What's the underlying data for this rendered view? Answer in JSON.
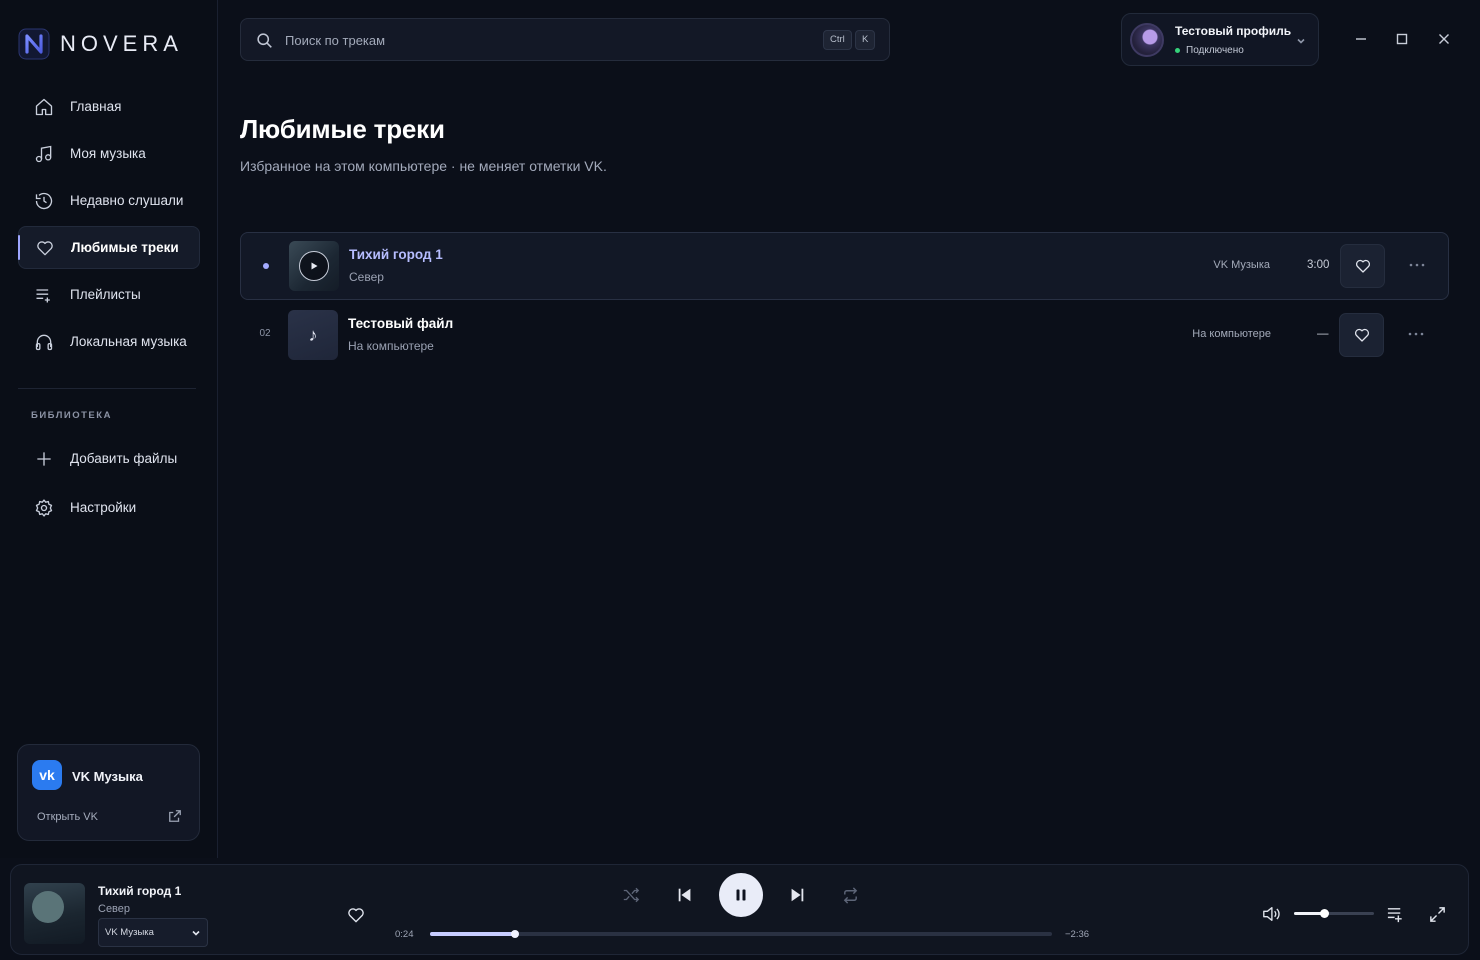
{
  "brand": {
    "name": "NOVERA"
  },
  "nav": {
    "items": [
      {
        "label": "Главная",
        "icon": "home-icon"
      },
      {
        "label": "Моя музыка",
        "icon": "music-note-icon"
      },
      {
        "label": "Недавно слушали",
        "icon": "history-icon"
      },
      {
        "label": "Любимые треки",
        "icon": "heart-icon",
        "active": true
      },
      {
        "label": "Плейлисты",
        "icon": "playlist-icon"
      },
      {
        "label": "Локальная музыка",
        "icon": "headphones-icon"
      }
    ]
  },
  "library": {
    "title": "БИБЛИОТЕКА",
    "items": [
      {
        "label": "Добавить файлы",
        "icon": "plus-icon"
      },
      {
        "label": "Настройки",
        "icon": "settings-gear-icon"
      }
    ]
  },
  "vk_card": {
    "title": "VK Музыка",
    "logo": "vk",
    "open_label": "Открыть VK"
  },
  "search": {
    "placeholder": "Поиск по трекам",
    "value": "",
    "shortcut": [
      "Ctrl",
      "K"
    ]
  },
  "profile": {
    "name": "Тестовый профиль",
    "status": "Подключено",
    "status_color": "#35d27a"
  },
  "page": {
    "title": "Любимые треки",
    "subtitle": "Избранное на этом компьютере · не меняет отметки VK."
  },
  "tracks": [
    {
      "index": "",
      "playing": true,
      "title": "Тихий город 1",
      "artist": "Север",
      "source": "VK Музыка",
      "duration": "3:00",
      "liked": true
    },
    {
      "index": "02",
      "playing": false,
      "title": "Тестовый файл",
      "artist": "На компьютере",
      "source": "На компьютере",
      "duration": "—",
      "liked": true,
      "cover_glyph": "♪"
    }
  ],
  "player": {
    "title": "Тихий город 1",
    "artist": "Север",
    "source_select": "VK Музыка",
    "elapsed": "0:24",
    "remaining": "−2:36",
    "progress": 0.137,
    "volume": 0.38,
    "accent": "#c7ccff"
  }
}
